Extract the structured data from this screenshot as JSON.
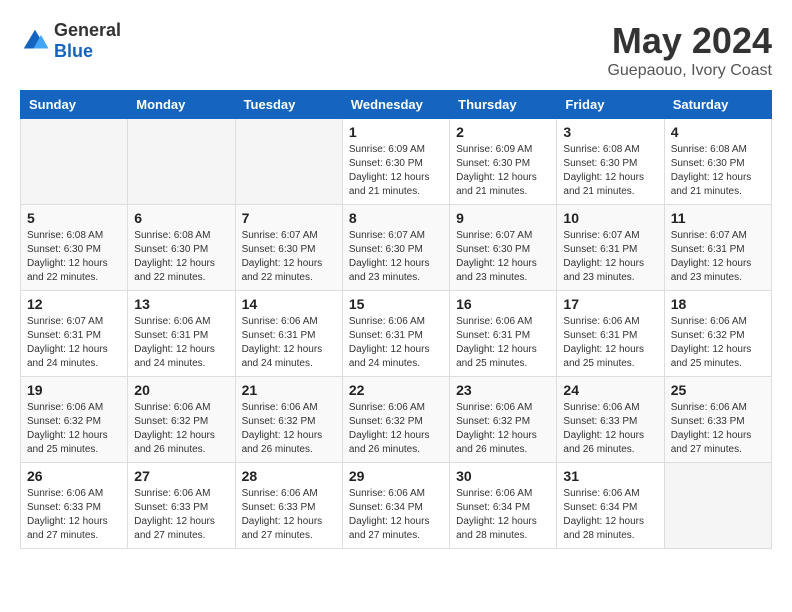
{
  "header": {
    "logo": {
      "general": "General",
      "blue": "Blue"
    },
    "title": "May 2024",
    "location": "Guepaouo, Ivory Coast"
  },
  "weekdays": [
    "Sunday",
    "Monday",
    "Tuesday",
    "Wednesday",
    "Thursday",
    "Friday",
    "Saturday"
  ],
  "weeks": [
    {
      "days": [
        {
          "num": "",
          "info": ""
        },
        {
          "num": "",
          "info": ""
        },
        {
          "num": "",
          "info": ""
        },
        {
          "num": "1",
          "info": "Sunrise: 6:09 AM\nSunset: 6:30 PM\nDaylight: 12 hours\nand 21 minutes."
        },
        {
          "num": "2",
          "info": "Sunrise: 6:09 AM\nSunset: 6:30 PM\nDaylight: 12 hours\nand 21 minutes."
        },
        {
          "num": "3",
          "info": "Sunrise: 6:08 AM\nSunset: 6:30 PM\nDaylight: 12 hours\nand 21 minutes."
        },
        {
          "num": "4",
          "info": "Sunrise: 6:08 AM\nSunset: 6:30 PM\nDaylight: 12 hours\nand 21 minutes."
        }
      ]
    },
    {
      "days": [
        {
          "num": "5",
          "info": "Sunrise: 6:08 AM\nSunset: 6:30 PM\nDaylight: 12 hours\nand 22 minutes."
        },
        {
          "num": "6",
          "info": "Sunrise: 6:08 AM\nSunset: 6:30 PM\nDaylight: 12 hours\nand 22 minutes."
        },
        {
          "num": "7",
          "info": "Sunrise: 6:07 AM\nSunset: 6:30 PM\nDaylight: 12 hours\nand 22 minutes."
        },
        {
          "num": "8",
          "info": "Sunrise: 6:07 AM\nSunset: 6:30 PM\nDaylight: 12 hours\nand 23 minutes."
        },
        {
          "num": "9",
          "info": "Sunrise: 6:07 AM\nSunset: 6:30 PM\nDaylight: 12 hours\nand 23 minutes."
        },
        {
          "num": "10",
          "info": "Sunrise: 6:07 AM\nSunset: 6:31 PM\nDaylight: 12 hours\nand 23 minutes."
        },
        {
          "num": "11",
          "info": "Sunrise: 6:07 AM\nSunset: 6:31 PM\nDaylight: 12 hours\nand 23 minutes."
        }
      ]
    },
    {
      "days": [
        {
          "num": "12",
          "info": "Sunrise: 6:07 AM\nSunset: 6:31 PM\nDaylight: 12 hours\nand 24 minutes."
        },
        {
          "num": "13",
          "info": "Sunrise: 6:06 AM\nSunset: 6:31 PM\nDaylight: 12 hours\nand 24 minutes."
        },
        {
          "num": "14",
          "info": "Sunrise: 6:06 AM\nSunset: 6:31 PM\nDaylight: 12 hours\nand 24 minutes."
        },
        {
          "num": "15",
          "info": "Sunrise: 6:06 AM\nSunset: 6:31 PM\nDaylight: 12 hours\nand 24 minutes."
        },
        {
          "num": "16",
          "info": "Sunrise: 6:06 AM\nSunset: 6:31 PM\nDaylight: 12 hours\nand 25 minutes."
        },
        {
          "num": "17",
          "info": "Sunrise: 6:06 AM\nSunset: 6:31 PM\nDaylight: 12 hours\nand 25 minutes."
        },
        {
          "num": "18",
          "info": "Sunrise: 6:06 AM\nSunset: 6:32 PM\nDaylight: 12 hours\nand 25 minutes."
        }
      ]
    },
    {
      "days": [
        {
          "num": "19",
          "info": "Sunrise: 6:06 AM\nSunset: 6:32 PM\nDaylight: 12 hours\nand 25 minutes."
        },
        {
          "num": "20",
          "info": "Sunrise: 6:06 AM\nSunset: 6:32 PM\nDaylight: 12 hours\nand 26 minutes."
        },
        {
          "num": "21",
          "info": "Sunrise: 6:06 AM\nSunset: 6:32 PM\nDaylight: 12 hours\nand 26 minutes."
        },
        {
          "num": "22",
          "info": "Sunrise: 6:06 AM\nSunset: 6:32 PM\nDaylight: 12 hours\nand 26 minutes."
        },
        {
          "num": "23",
          "info": "Sunrise: 6:06 AM\nSunset: 6:32 PM\nDaylight: 12 hours\nand 26 minutes."
        },
        {
          "num": "24",
          "info": "Sunrise: 6:06 AM\nSunset: 6:33 PM\nDaylight: 12 hours\nand 26 minutes."
        },
        {
          "num": "25",
          "info": "Sunrise: 6:06 AM\nSunset: 6:33 PM\nDaylight: 12 hours\nand 27 minutes."
        }
      ]
    },
    {
      "days": [
        {
          "num": "26",
          "info": "Sunrise: 6:06 AM\nSunset: 6:33 PM\nDaylight: 12 hours\nand 27 minutes."
        },
        {
          "num": "27",
          "info": "Sunrise: 6:06 AM\nSunset: 6:33 PM\nDaylight: 12 hours\nand 27 minutes."
        },
        {
          "num": "28",
          "info": "Sunrise: 6:06 AM\nSunset: 6:33 PM\nDaylight: 12 hours\nand 27 minutes."
        },
        {
          "num": "29",
          "info": "Sunrise: 6:06 AM\nSunset: 6:34 PM\nDaylight: 12 hours\nand 27 minutes."
        },
        {
          "num": "30",
          "info": "Sunrise: 6:06 AM\nSunset: 6:34 PM\nDaylight: 12 hours\nand 28 minutes."
        },
        {
          "num": "31",
          "info": "Sunrise: 6:06 AM\nSunset: 6:34 PM\nDaylight: 12 hours\nand 28 minutes."
        },
        {
          "num": "",
          "info": ""
        }
      ]
    }
  ]
}
